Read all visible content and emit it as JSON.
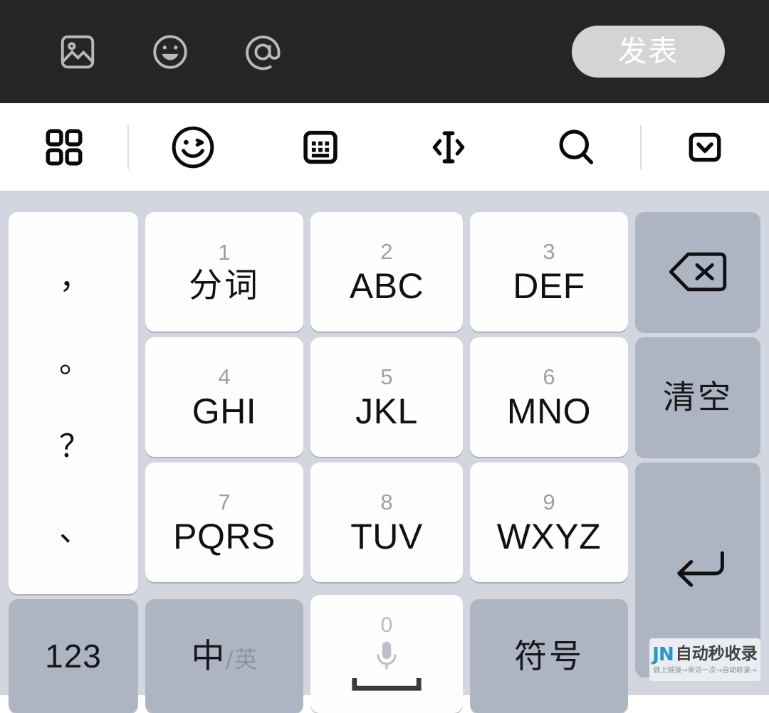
{
  "composer": {
    "icons": [
      {
        "name": "image-icon",
        "label": "图片"
      },
      {
        "name": "emoji-icon",
        "label": "表情"
      },
      {
        "name": "mention-icon",
        "label": "@"
      }
    ],
    "publish_label": "发表",
    "bar_color": "#252525",
    "publish_bg": "#d4d4d4"
  },
  "function_bar": {
    "items": [
      {
        "name": "apps-grid-icon",
        "label": "工具"
      },
      {
        "name": "emoji-wink-icon",
        "label": "表情"
      },
      {
        "name": "keyboard-icon",
        "label": "键盘"
      },
      {
        "name": "cursor-move-icon",
        "label": "移动光标"
      },
      {
        "name": "search-icon",
        "label": "搜索"
      },
      {
        "name": "hide-keyboard-icon",
        "label": "收起键盘"
      }
    ]
  },
  "keyboard": {
    "bg_color": "#d3d6de",
    "key_white": "#fefeff",
    "key_gray": "#adb4c2",
    "punctuation_key": {
      "name": "punctuation-key",
      "chars": [
        "，",
        "。",
        "？",
        "、"
      ]
    },
    "alpha_keys": [
      {
        "digit": "1",
        "letters": "分词",
        "cn": true
      },
      {
        "digit": "2",
        "letters": "ABC",
        "cn": false
      },
      {
        "digit": "3",
        "letters": "DEF",
        "cn": false
      },
      {
        "digit": "4",
        "letters": "GHI",
        "cn": false
      },
      {
        "digit": "5",
        "letters": "JKL",
        "cn": false
      },
      {
        "digit": "6",
        "letters": "MNO",
        "cn": false
      },
      {
        "digit": "7",
        "letters": "PQRS",
        "cn": false
      },
      {
        "digit": "8",
        "letters": "TUV",
        "cn": false
      },
      {
        "digit": "9",
        "letters": "WXYZ",
        "cn": false
      }
    ],
    "right_keys": [
      {
        "name": "backspace-key",
        "label": "退格"
      },
      {
        "name": "clear-key",
        "label": "清空"
      },
      {
        "name": "enter-key",
        "label": "换行"
      }
    ],
    "bottom_keys": {
      "numeric": "123",
      "lang_cn": "中",
      "lang_sep": "/",
      "lang_en": "英",
      "space_digit": "0",
      "symbol": "符号"
    }
  },
  "watermark": {
    "logo": "JN",
    "title": "自动秒收录",
    "subtitle": "做上链接→来访一次→自动收录→"
  }
}
